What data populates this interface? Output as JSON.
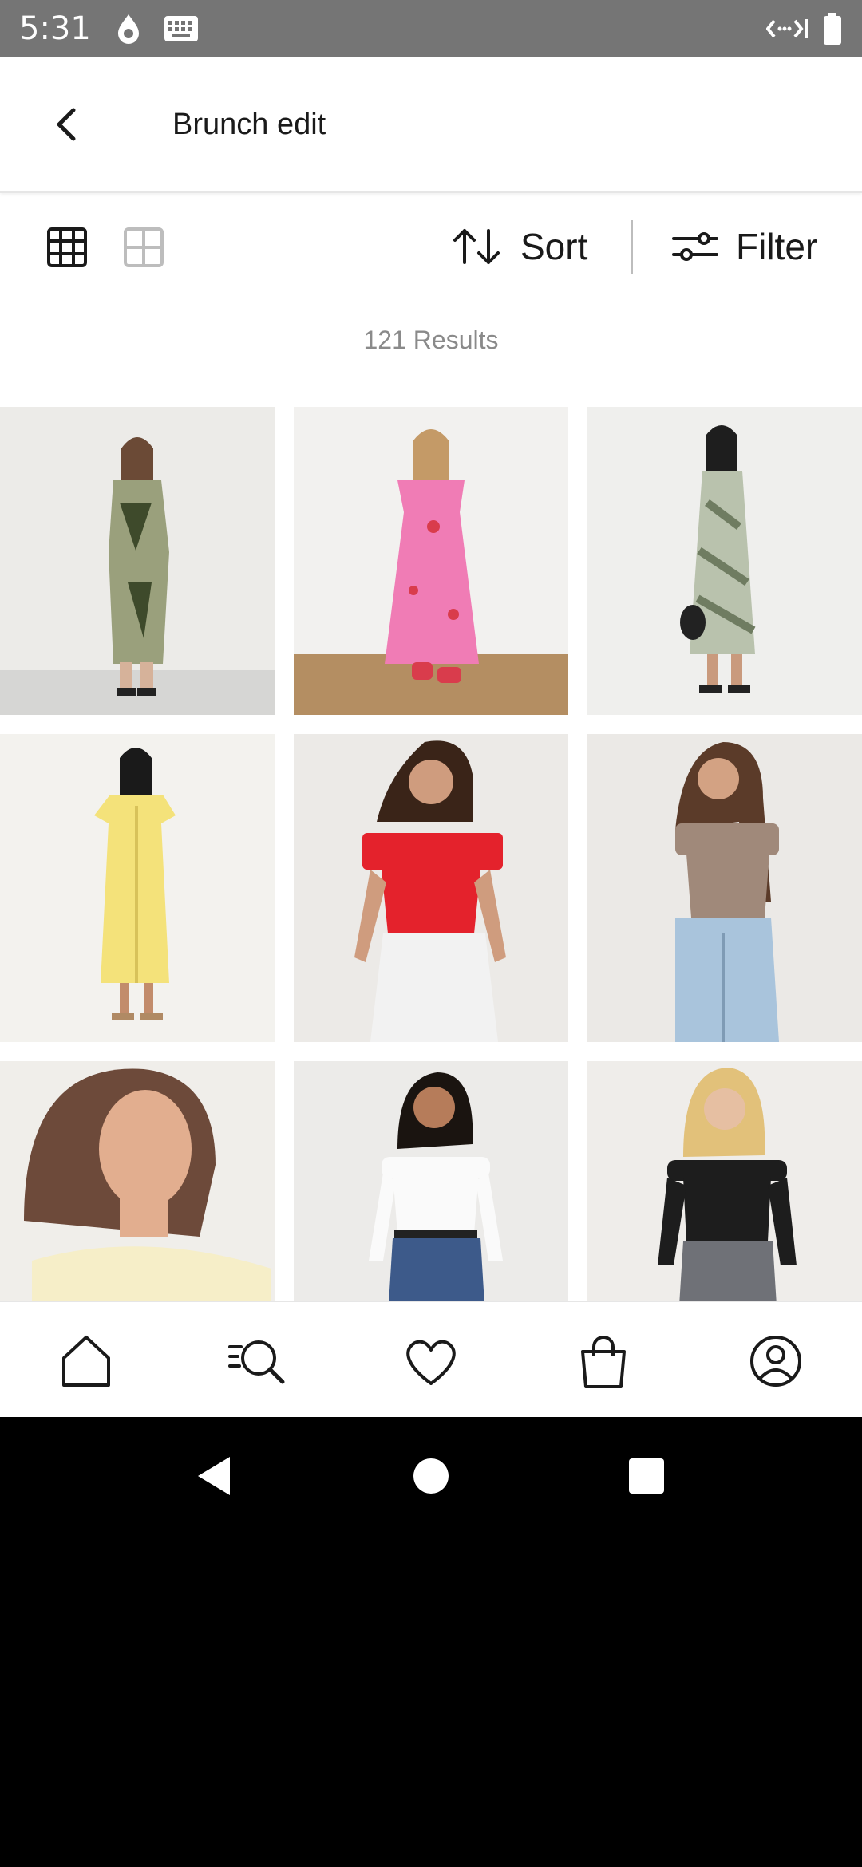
{
  "status_bar": {
    "time": "5:31",
    "icons": [
      "drop-icon",
      "keyboard-icon",
      "code-signal-icon",
      "battery-icon"
    ]
  },
  "header": {
    "title": "Brunch edit",
    "back_icon": "chevron-left-icon"
  },
  "toolbar": {
    "grid_views": [
      "grid-3-icon",
      "grid-2-icon"
    ],
    "sort_label": "Sort",
    "filter_label": "Filter"
  },
  "results_text": "121 Results",
  "products": [
    {
      "name": "camo-print-midi-dress",
      "colors": {
        "bg": "#ecebe8",
        "outfit": "#9aa07c",
        "accent": "#3e4a2b"
      }
    },
    {
      "name": "pink-floral-midi-dress",
      "colors": {
        "bg": "#f2f1ef",
        "outfit": "#f07cb5",
        "accent": "#d93c4c"
      }
    },
    {
      "name": "green-zebra-slip-dress",
      "colors": {
        "bg": "#efefed",
        "outfit": "#b9c2ad",
        "accent": "#6f7c61"
      }
    },
    {
      "name": "yellow-button-midi-dress",
      "colors": {
        "bg": "#f3f2ee",
        "outfit": "#f4e27a",
        "accent": "#d8c25a"
      }
    },
    {
      "name": "red-bardot-top",
      "colors": {
        "bg": "#eceae7",
        "outfit": "#e4222c",
        "accent": "#f2f2f2"
      }
    },
    {
      "name": "mink-bardot-top",
      "colors": {
        "bg": "#ebe9e6",
        "outfit": "#a0897a",
        "accent": "#a9c4dc"
      }
    },
    {
      "name": "cream-bardot-top",
      "colors": {
        "bg": "#f0eeea",
        "outfit": "#f6eec8",
        "accent": "#6d4a3a"
      }
    },
    {
      "name": "white-off-shoulder-top",
      "colors": {
        "bg": "#ecebe9",
        "outfit": "#fafafa",
        "accent": "#3d5a8a"
      }
    },
    {
      "name": "black-off-shoulder-bodysuit",
      "colors": {
        "bg": "#efedea",
        "outfit": "#1d1d1d",
        "accent": "#6f7177"
      }
    }
  ],
  "bottom_nav": {
    "items": [
      "home-icon",
      "search-icon",
      "wishlist-heart-icon",
      "bag-icon",
      "account-icon"
    ]
  },
  "system_nav": [
    "back-triangle-icon",
    "home-circle-icon",
    "recents-square-icon"
  ]
}
